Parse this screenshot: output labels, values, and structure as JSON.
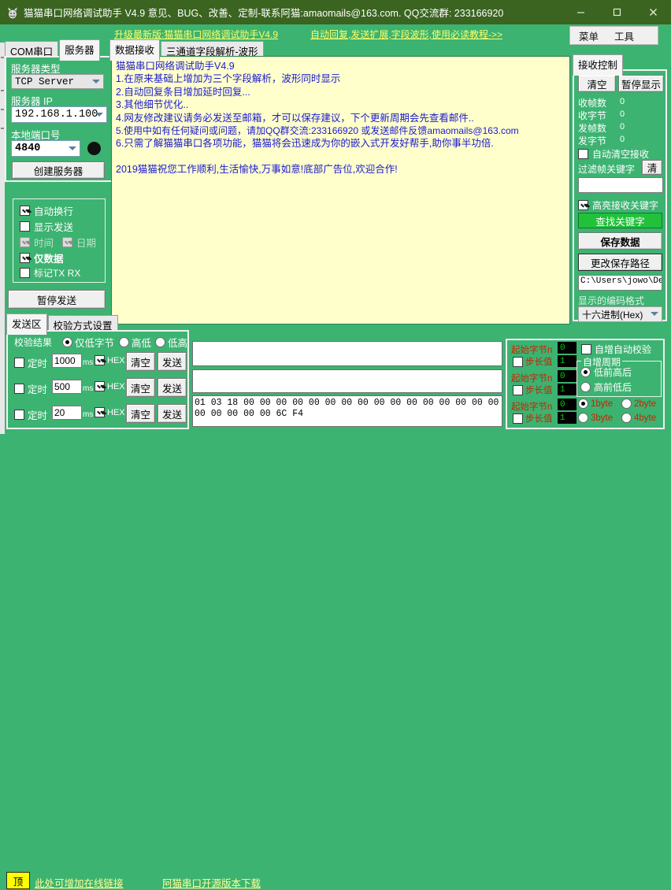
{
  "window": {
    "title": "猫猫串口网络调试助手 V4.9 意见、BUG、改善、定制-联系阿猫:amaomails@163.com. QQ交流群: 233166920",
    "icon": "cat-icon",
    "minimize": "−",
    "maximize": "□",
    "close": "✕"
  },
  "linkbar": {
    "link_update": "升级最新版:猫猫串口网络调试助手V4.9",
    "link_tutorial": "自动回复,发送扩展,字段波形,使用必读教程->>",
    "menu": "菜单",
    "tool": "工具"
  },
  "left": {
    "tabs": [
      {
        "label": "COM串口",
        "selected": false
      },
      {
        "label": "服务器",
        "selected": true
      }
    ],
    "server_type_label": "服务器类型",
    "server_type_value": "TCP Server",
    "server_ip_label": "服务器 IP",
    "server_ip_value": "192.168.1.100",
    "local_port_label": "本地端口号",
    "local_port_value": "4840",
    "create_server_button": "创建服务器",
    "options": [
      {
        "label": "自动换行",
        "checked": true,
        "disabled": false,
        "bold": false
      },
      {
        "label": "显示发送",
        "checked": false,
        "disabled": false,
        "bold": false
      },
      {
        "label": "时间",
        "checked": true,
        "disabled": true,
        "bold": false
      },
      {
        "label": "日期",
        "checked": true,
        "disabled": true,
        "bold": false
      },
      {
        "label": "仅数据",
        "checked": true,
        "disabled": false,
        "bold": true
      },
      {
        "label": "标记TX RX",
        "checked": false,
        "disabled": false,
        "bold": false
      }
    ],
    "pause_send_button": "暂停发送"
  },
  "center": {
    "tabs": [
      {
        "label": "数据接收",
        "selected": true
      },
      {
        "label": "三通道字段解析-波形",
        "selected": false
      }
    ],
    "receive_lines": [
      "猫猫串口网络调试助手V4.9",
      "1.在原来基础上增加为三个字段解析，波形同时显示",
      "2.自动回复条目增加延时回复...",
      "3.其他细节优化..",
      "4.网友修改建议请务必发送至邮箱，才可以保存建议，下个更新周期会先查看邮件..",
      "5.使用中如有任何疑问或问题，请加QQ群交流:233166920 或发送邮件反馈amaomails@163.com",
      "6.只需了解猫猫串口各项功能，猫猫将会迅速成为你的嵌入式开发好帮手,助你事半功倍.",
      "",
      "2019猫猫祝您工作顺利,生活愉快,万事如意!底部广告位,欢迎合作!"
    ]
  },
  "right": {
    "tab_label": "接收控制",
    "clear_button": "清空",
    "pause_display_button": "暂停显示",
    "stats": [
      {
        "label": "收帧数",
        "value": "0"
      },
      {
        "label": "收字节",
        "value": "0"
      },
      {
        "label": "发帧数",
        "value": "0"
      },
      {
        "label": "发字节",
        "value": "0"
      }
    ],
    "auto_clear_label": "自动清空接收",
    "auto_clear_checked": false,
    "filter_label": "过滤帧关键字",
    "filter_clear_button": "清",
    "filter_value": "",
    "highlight_label": "高亮接收关键字",
    "highlight_checked": true,
    "find_keyword_button": "查找关键字",
    "save_data_button": "保存数据",
    "change_path_button": "更改保存路径",
    "save_path_value": "C:\\Users\\jowo\\De",
    "encoding_label": "显示的编码格式",
    "encoding_value": "十六进制(Hex)"
  },
  "send": {
    "tabs": [
      {
        "label": "发送区",
        "selected": true
      },
      {
        "label": "校验方式设置",
        "selected": false
      }
    ],
    "check_result_label": "校验结果",
    "check_options": [
      {
        "label": "仅低字节",
        "checked": true
      },
      {
        "label": "高低",
        "checked": false
      },
      {
        "label": "低高",
        "checked": false
      }
    ],
    "rows": [
      {
        "timer_label": "定时",
        "timer_checked": false,
        "interval": "1000",
        "unit": "ms",
        "hex_label": "HEX",
        "hex_checked": true,
        "clear_label": "清空",
        "send_label": "发送"
      },
      {
        "timer_label": "定时",
        "timer_checked": false,
        "interval": "500",
        "unit": "ms",
        "hex_label": "HEX",
        "hex_checked": true,
        "clear_label": "清空",
        "send_label": "发送"
      },
      {
        "timer_label": "定时",
        "timer_checked": false,
        "interval": "20",
        "unit": "ms",
        "hex_label": "HEX",
        "hex_checked": true,
        "clear_label": "清空",
        "send_label": "发送"
      }
    ],
    "inputs": [
      {
        "value": ""
      },
      {
        "value": ""
      },
      {
        "value": "01 03 18 00 00 00 00 00 00 00 00 00 00 00 00 00 00 00 00 00 00 00\n00 00 00 00 00 6C F4"
      }
    ]
  },
  "autoinc": {
    "rows": [
      {
        "start_label": "起始字节n",
        "start_value": "0",
        "step_label": "步长值",
        "step_checked": false,
        "step_value": "1"
      },
      {
        "start_label": "起始字节n",
        "start_value": "0",
        "step_label": "步长值",
        "step_checked": false,
        "step_value": "1"
      },
      {
        "start_label": "起始字节n",
        "start_value": "0",
        "step_label": "步长值",
        "step_checked": false,
        "step_value": "1"
      }
    ],
    "auto_check_label": "自增自动校验",
    "auto_check_checked": false,
    "period_group_label": "自增周期",
    "order_options": [
      {
        "label": "低前高后",
        "checked": true
      },
      {
        "label": "高前低后",
        "checked": false
      }
    ],
    "byte_options": [
      {
        "label": "1byte",
        "checked": true
      },
      {
        "label": "2byte",
        "checked": false
      },
      {
        "label": "3byte",
        "checked": false
      },
      {
        "label": "4byte",
        "checked": false
      }
    ]
  },
  "status": {
    "top_button": "顶",
    "link_left": "此处可增加在线链接",
    "link_center": "阿猫串口开源版本下载"
  },
  "colors": {
    "window_bg": "#3cb371",
    "titlebar": "#3a6420",
    "receive_bg": "#ffffcc",
    "receive_text": "#1a1ad0",
    "link": "#ffff66",
    "find_button": "#22c13a"
  }
}
